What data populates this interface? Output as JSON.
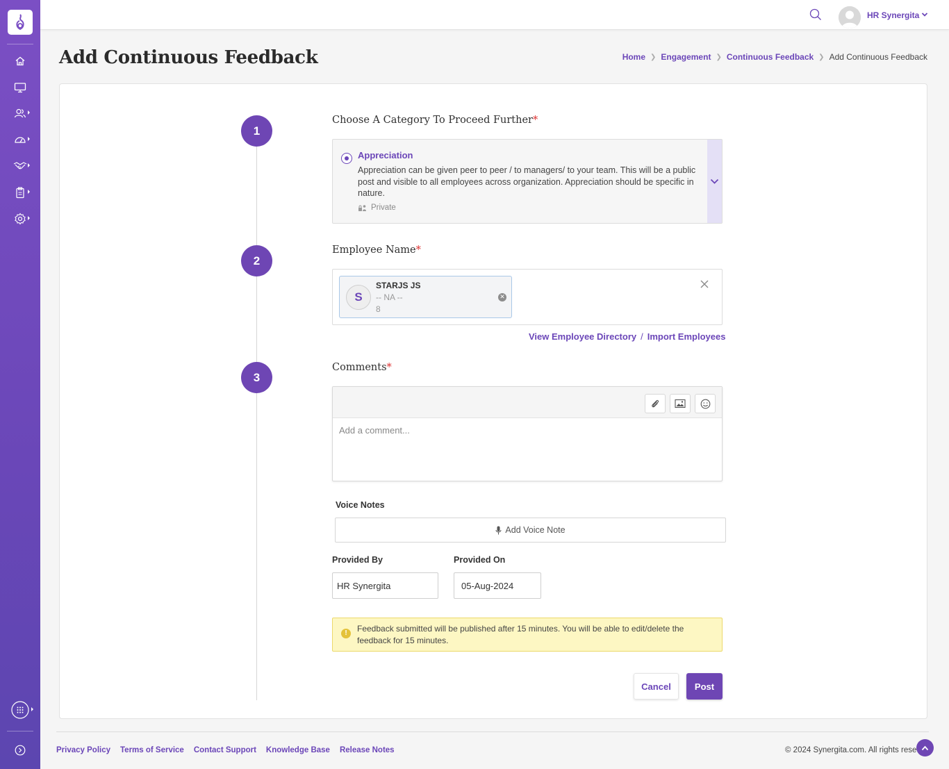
{
  "sidebar": {
    "items": [
      {
        "icon": "home-icon",
        "has_submenu": false
      },
      {
        "icon": "monitor-icon",
        "has_submenu": false
      },
      {
        "icon": "users-icon",
        "has_submenu": true
      },
      {
        "icon": "dashboard-icon",
        "has_submenu": true
      },
      {
        "icon": "handshake-icon",
        "has_submenu": true
      },
      {
        "icon": "clipboard-icon",
        "has_submenu": true
      },
      {
        "icon": "settings-icon",
        "has_submenu": true
      }
    ],
    "bottom": [
      {
        "icon": "apps-grid-icon"
      },
      {
        "icon": "expand-icon"
      }
    ],
    "brand_color": "#7b4fc4"
  },
  "topbar": {
    "user_name": "HR Synergita"
  },
  "page": {
    "title": "Add Continuous Feedback",
    "breadcrumb": [
      "Home",
      "Engagement",
      "Continuous Feedback",
      "Add Continuous Feedback"
    ]
  },
  "steps": [
    "1",
    "2",
    "3"
  ],
  "category": {
    "heading": "Choose A Category To Proceed Further",
    "required_mark": "*",
    "selected_name": "Appreciation",
    "description": "Appreciation can be given peer to peer / to managers/ to your team. This will be a public post and visible to all employees across organization. Appreciation should be specific in nature.",
    "visibility": "Private"
  },
  "employee": {
    "heading": "Employee Name",
    "required_mark": "*",
    "selected": {
      "initial": "S",
      "name": "STARJS JS",
      "designation": "-- NA --",
      "code": "8"
    },
    "view_directory_link": "View Employee Directory",
    "separator": "/",
    "import_link": "Import Employees"
  },
  "comments": {
    "heading": "Comments",
    "required_mark": "*",
    "placeholder": "Add a comment...",
    "tools": [
      "attachment-icon",
      "image-icon",
      "emoji-icon"
    ]
  },
  "voice_notes": {
    "label": "Voice Notes",
    "button": "Add Voice Note"
  },
  "provided_by": {
    "label": "Provided By",
    "value": "HR Synergita"
  },
  "provided_on": {
    "label": "Provided On",
    "value": "05-Aug-2024"
  },
  "notice": {
    "icon_text": "!",
    "text": "Feedback submitted will be published after 15 minutes. You will be able to edit/delete the feedback for 15 minutes."
  },
  "actions": {
    "cancel": "Cancel",
    "post": "Post"
  },
  "footer": {
    "links": [
      "Privacy Policy",
      "Terms of Service",
      "Contact Support",
      "Knowledge Base",
      "Release Notes"
    ],
    "copyright": "© 2024 Synergita.com. All rights reserved."
  }
}
